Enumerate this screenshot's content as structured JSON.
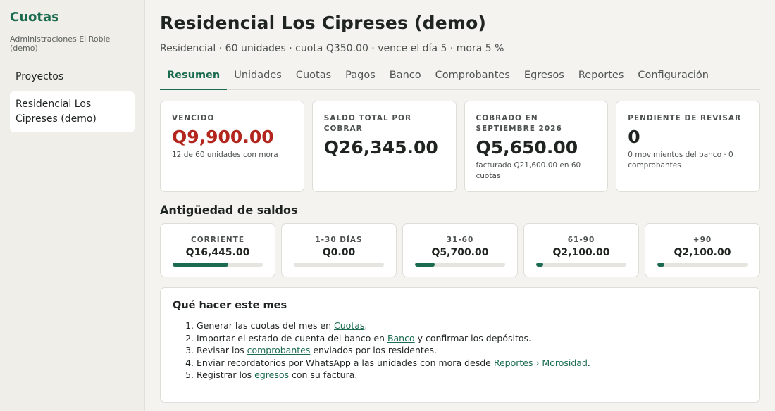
{
  "sidebar": {
    "brand": "Cuotas",
    "org": "Administraciones El Roble (demo)",
    "items": [
      {
        "label": "Proyectos"
      },
      {
        "label": "Residencial Los Cipreses (demo)"
      }
    ]
  },
  "header": {
    "title": "Residencial Los Cipreses (demo)",
    "subtitle": "Residencial · 60 unidades · cuota Q350.00 · vence el día 5 · mora 5 %"
  },
  "tabs": [
    "Resumen",
    "Unidades",
    "Cuotas",
    "Pagos",
    "Banco",
    "Comprobantes",
    "Egresos",
    "Reportes",
    "Configuración"
  ],
  "kpis": [
    {
      "label": "VENCIDO",
      "value": "Q9,900.00",
      "note": "12 de 60 unidades con mora"
    },
    {
      "label": "SALDO TOTAL POR COBRAR",
      "value": "Q26,345.00",
      "note": ""
    },
    {
      "label": "COBRADO EN SEPTIEMBRE 2026",
      "value": "Q5,650.00",
      "note": "facturado Q21,600.00 en 60 cuotas"
    },
    {
      "label": "PENDIENTE DE REVISAR",
      "value": "0",
      "note": "0 movimientos del banco · 0 comprobantes"
    }
  ],
  "aging": {
    "title": "Antigüedad de saldos",
    "buckets": [
      {
        "label": "CORRIENTE",
        "amount": "Q16,445.00",
        "fraction": 0.62
      },
      {
        "label": "1-30 DÍAS",
        "amount": "Q0.00",
        "fraction": 0
      },
      {
        "label": "31-60",
        "amount": "Q5,700.00",
        "fraction": 0.22
      },
      {
        "label": "61-90",
        "amount": "Q2,100.00",
        "fraction": 0.08
      },
      {
        "label": "+90",
        "amount": "Q2,100.00",
        "fraction": 0.08
      }
    ]
  },
  "todo": {
    "title": "Qué hacer este mes",
    "steps": [
      {
        "pre": "Generar las cuotas del mes en ",
        "link": "Cuotas",
        "post": "."
      },
      {
        "pre": "Importar el estado de cuenta del banco en ",
        "link": "Banco",
        "post": " y confirmar los depósitos."
      },
      {
        "pre": "Revisar los ",
        "link": "comprobantes",
        "post": " enviados por los residentes."
      },
      {
        "pre": "Enviar recordatorios por WhatsApp a las unidades con mora desde ",
        "link": "Reportes › Morosidad",
        "post": "."
      },
      {
        "pre": "Registrar los ",
        "link": "egresos",
        "post": " con su factura."
      }
    ]
  },
  "colors": {
    "accent": "#1a6b4f",
    "danger": "#b3261e"
  }
}
